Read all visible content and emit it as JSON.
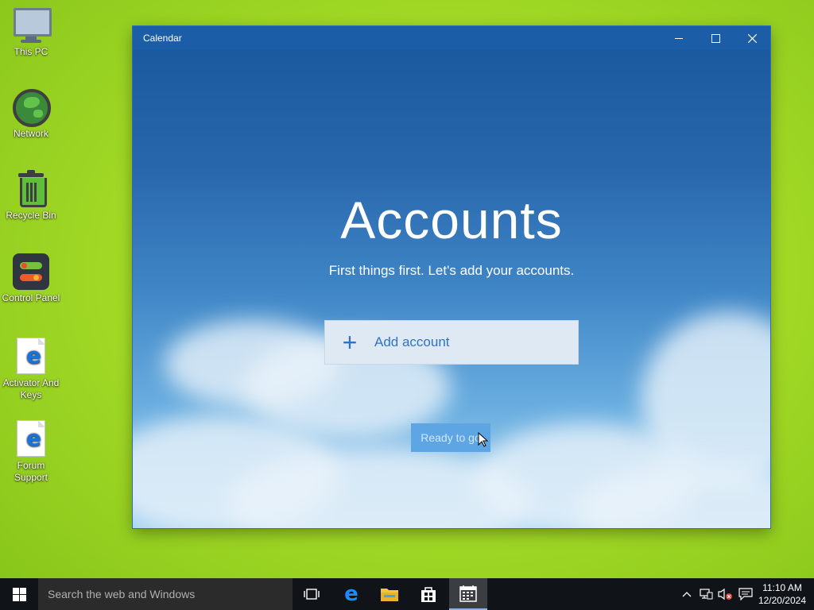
{
  "desktop": {
    "icons": [
      {
        "label": "This PC"
      },
      {
        "label": "Network"
      },
      {
        "label": "Recycle Bin"
      },
      {
        "label": "Control Panel"
      },
      {
        "label": "Activator And Keys"
      },
      {
        "label": "Forum Support"
      }
    ]
  },
  "window": {
    "title": "Calendar",
    "controls": {
      "minimize_icon": "minimize-icon",
      "maximize_icon": "maximize-icon",
      "close_icon": "close-icon"
    }
  },
  "accounts": {
    "heading": "Accounts",
    "subtitle": "First things first. Let's add your accounts.",
    "add_account": "Add account",
    "add_icon": "plus-icon",
    "ready_button": "Ready to go"
  },
  "taskbar": {
    "search_placeholder": "Search the web and Windows",
    "pinned": [
      "task-view",
      "edge",
      "file-explorer",
      "store",
      "calendar"
    ],
    "active_app": "calendar",
    "clock": {
      "time": "11:10 AM",
      "date": "12/20/2024"
    }
  },
  "colors": {
    "titlebar": "#1b5ea7",
    "accent_text": "#2e74c3",
    "desktop": "#a6dc27",
    "taskbar": "#101418"
  }
}
